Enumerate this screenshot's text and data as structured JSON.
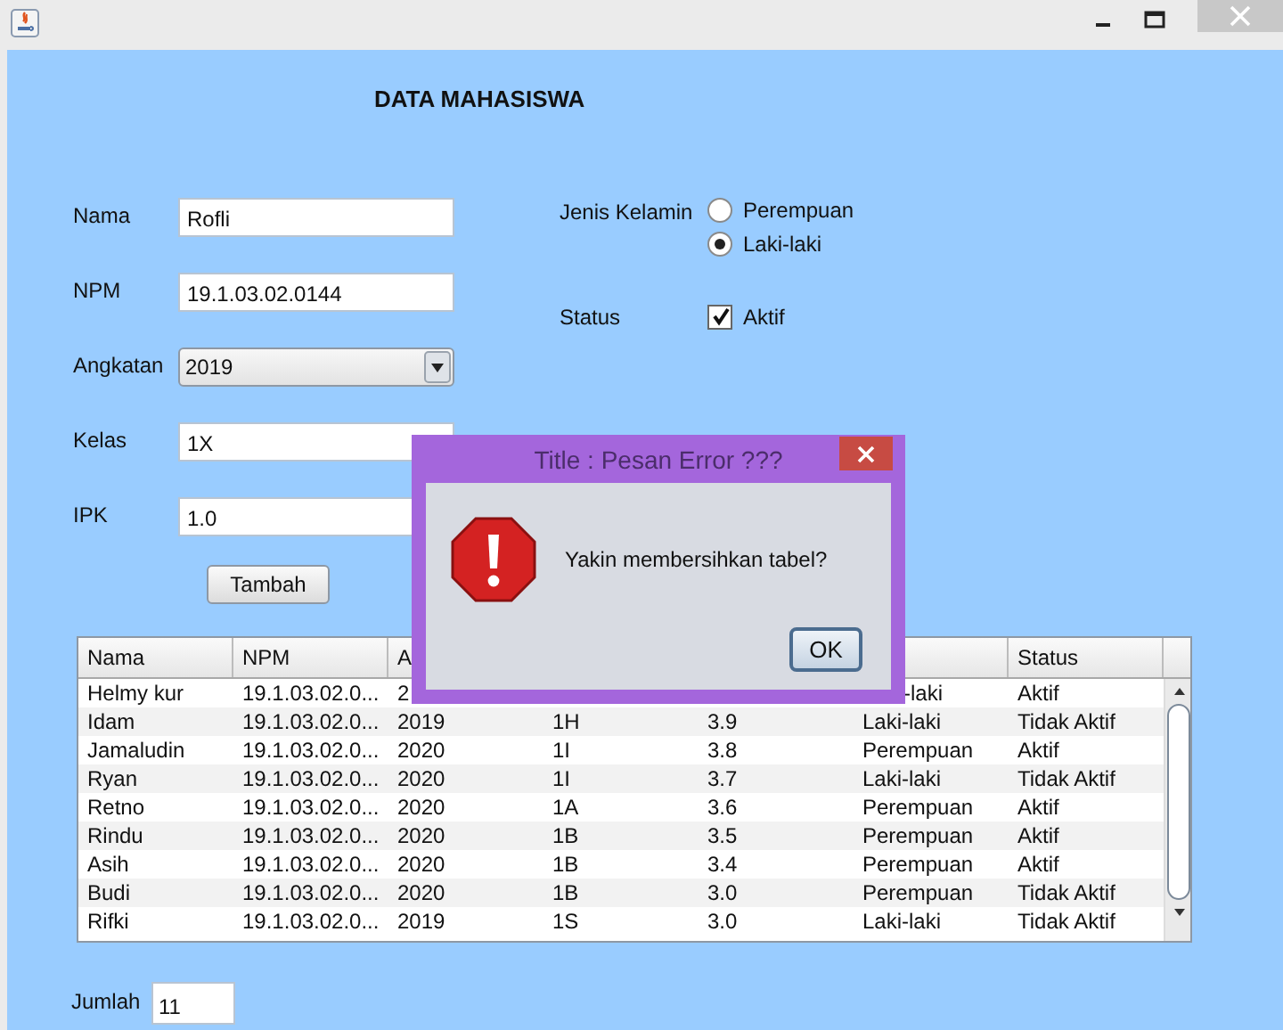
{
  "heading": "DATA MAHASISWA",
  "form": {
    "fields": [
      {
        "label": "Nama",
        "kind": "text",
        "value": "Rofli"
      },
      {
        "label": "NPM",
        "kind": "text",
        "value": "19.1.03.02.0144"
      },
      {
        "label": "Angkatan",
        "kind": "combo",
        "value": "2019"
      },
      {
        "label": "Kelas",
        "kind": "text",
        "value": "1X"
      },
      {
        "label": "IPK",
        "kind": "text",
        "value": "1.0"
      }
    ],
    "add_button": "Tambah"
  },
  "gender": {
    "label": "Jenis Kelamin",
    "options": [
      {
        "label": "Perempuan",
        "selected": false
      },
      {
        "label": "Laki-laki",
        "selected": true
      }
    ]
  },
  "status": {
    "label": "Status",
    "checkbox": {
      "label": "Aktif",
      "checked": true
    }
  },
  "table": {
    "columns": [
      {
        "label": "Nama"
      },
      {
        "label": "NPM"
      },
      {
        "label": "A"
      },
      {},
      {},
      {},
      {
        "label": "Status"
      }
    ],
    "rows": [
      [
        "Helmy kur",
        "19.1.03.02.0...",
        "2",
        null,
        null,
        {
          "text": "-laki",
          "cut": true
        },
        "Aktif"
      ],
      [
        "Idam",
        "19.1.03.02.0...",
        "2019",
        "1H",
        "3.9",
        "Laki-laki",
        "Tidak Aktif"
      ],
      [
        "Jamaludin",
        "19.1.03.02.0...",
        "2020",
        "1I",
        "3.8",
        "Perempuan",
        "Aktif"
      ],
      [
        "Ryan",
        "19.1.03.02.0...",
        "2020",
        "1I",
        "3.7",
        "Laki-laki",
        "Tidak Aktif"
      ],
      [
        "Retno",
        "19.1.03.02.0...",
        "2020",
        "1A",
        "3.6",
        "Perempuan",
        "Aktif"
      ],
      [
        "Rindu",
        "19.1.03.02.0...",
        "2020",
        "1B",
        "3.5",
        "Perempuan",
        "Aktif"
      ],
      [
        "Asih",
        "19.1.03.02.0...",
        "2020",
        "1B",
        "3.4",
        "Perempuan",
        "Aktif"
      ],
      [
        "Budi",
        "19.1.03.02.0...",
        "2020",
        "1B",
        "3.0",
        "Perempuan",
        "Tidak Aktif"
      ],
      [
        "Rifki",
        "19.1.03.02.0...",
        "2019",
        "1S",
        "3.0",
        "Laki-laki",
        "Tidak Aktif"
      ]
    ]
  },
  "count": {
    "label": "Jumlah",
    "value": "11"
  },
  "dialog": {
    "title": "Title : Pesan Error ???",
    "message": "Yakin membersihkan tabel?",
    "button": "OK"
  }
}
